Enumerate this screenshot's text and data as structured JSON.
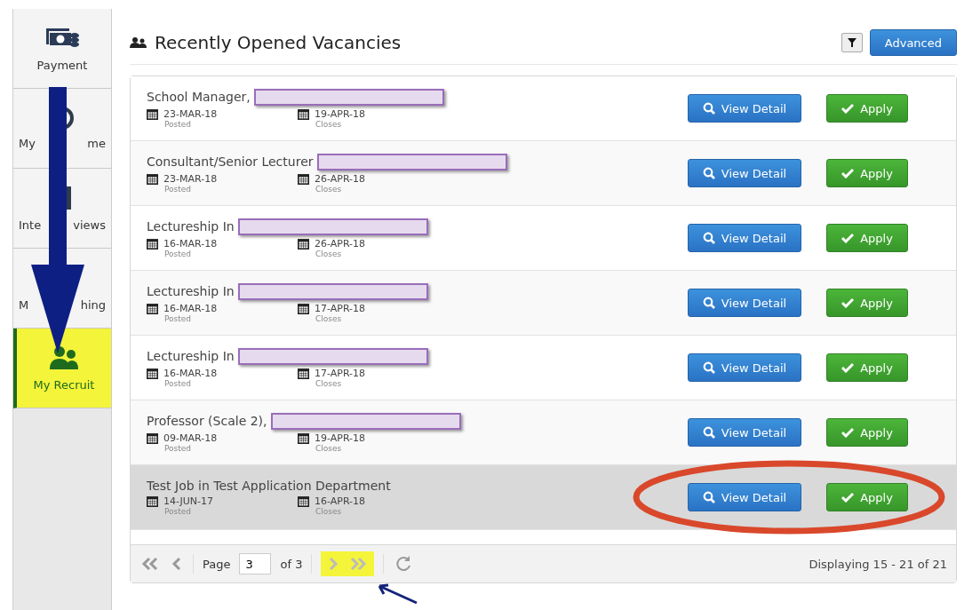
{
  "sidebar": {
    "items": [
      {
        "label_parts": [
          "Payment"
        ],
        "selected": false,
        "highlighted": false
      },
      {
        "label_parts": [
          "My",
          "me"
        ],
        "selected": false,
        "highlighted": false
      },
      {
        "label_parts": [
          "Inte",
          "views"
        ],
        "selected": false,
        "highlighted": false
      },
      {
        "label_parts": [
          "M",
          "hing"
        ],
        "selected": false,
        "highlighted": false
      },
      {
        "label_parts": [
          "My Recruit"
        ],
        "selected": true,
        "highlighted": true
      }
    ]
  },
  "header": {
    "title": "Recently Opened Vacancies",
    "button": "Advanced"
  },
  "vacancies": [
    {
      "title": "School Manager,",
      "redacted": true,
      "posted": "23-MAR-18",
      "posted_label": "Posted",
      "closes": "19-APR-18",
      "closes_label": "Closes",
      "view": "View Detail",
      "apply": "Apply",
      "selected": false,
      "circled": false
    },
    {
      "title": "Consultant/Senior Lecturer",
      "redacted": true,
      "posted": "23-MAR-18",
      "posted_label": "Posted",
      "closes": "26-APR-18",
      "closes_label": "Closes",
      "view": "View Detail",
      "apply": "Apply",
      "selected": false,
      "circled": false
    },
    {
      "title": "Lectureship In",
      "redacted": true,
      "posted": "16-MAR-18",
      "posted_label": "Posted",
      "closes": "26-APR-18",
      "closes_label": "Closes",
      "view": "View Detail",
      "apply": "Apply",
      "selected": false,
      "circled": false
    },
    {
      "title": "Lectureship In",
      "redacted": true,
      "posted": "16-MAR-18",
      "posted_label": "Posted",
      "closes": "17-APR-18",
      "closes_label": "Closes",
      "view": "View Detail",
      "apply": "Apply",
      "selected": false,
      "circled": false
    },
    {
      "title": "Lectureship In",
      "redacted": true,
      "posted": "16-MAR-18",
      "posted_label": "Posted",
      "closes": "17-APR-18",
      "closes_label": "Closes",
      "view": "View Detail",
      "apply": "Apply",
      "selected": false,
      "circled": false
    },
    {
      "title": "Professor (Scale 2),",
      "redacted": true,
      "posted": "09-MAR-18",
      "posted_label": "Posted",
      "closes": "19-APR-18",
      "closes_label": "Closes",
      "view": "View Detail",
      "apply": "Apply",
      "selected": false,
      "circled": false
    },
    {
      "title": "Test Job in Test Application Department",
      "redacted": false,
      "posted": "14-JUN-17",
      "posted_label": "Posted",
      "closes": "16-APR-18",
      "closes_label": "Closes",
      "view": "View Detail",
      "apply": "Apply",
      "selected": true,
      "circled": true
    }
  ],
  "pager": {
    "page_label": "Page",
    "page": "3",
    "of": "of 3",
    "next_highlighted": true,
    "displaying": "Displaying 15 - 21 of 21"
  }
}
